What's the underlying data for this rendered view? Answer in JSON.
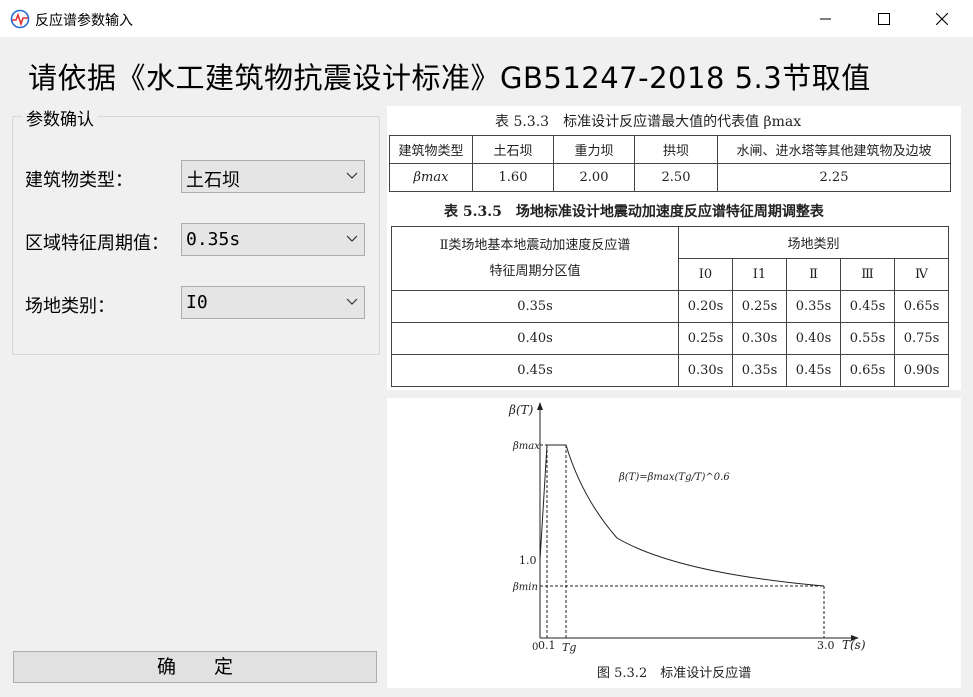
{
  "window": {
    "title": "反应谱参数输入"
  },
  "header": {
    "title": "请依据《水工建筑物抗震设计标准》GB51247-2018 5.3节取值"
  },
  "group": {
    "title": "参数确认"
  },
  "fields": {
    "building_type_label": "建筑物类型：",
    "building_type_value": "土石坝",
    "period_label": "区域特征周期值：",
    "period_value": "0.35s",
    "site_label": "场地类别：",
    "site_value": "I0"
  },
  "confirm_label": "确定",
  "table1": {
    "caption": "表 5.3.3　标准设计反应谱最大值的代表值 βmax",
    "header": [
      "建筑物类型",
      "土石坝",
      "重力坝",
      "拱坝",
      "水闸、进水塔等其他建筑物及边坡"
    ],
    "row_label": "βmax",
    "values": [
      "1.60",
      "2.00",
      "2.50",
      "2.25"
    ]
  },
  "table2": {
    "caption": "表 5.3.5　场地标准设计地震动加速度反应谱特征周期调整表",
    "left_header_line1": "Ⅱ类场地基本地震动加速度反应谱",
    "left_header_line2": "特征周期分区值",
    "group_header": "场地类别",
    "site_classes": [
      "I0",
      "I1",
      "Ⅱ",
      "Ⅲ",
      "Ⅳ"
    ],
    "rows": [
      {
        "zone": "0.35s",
        "values": [
          "0.20s",
          "0.25s",
          "0.35s",
          "0.45s",
          "0.65s"
        ]
      },
      {
        "zone": "0.40s",
        "values": [
          "0.25s",
          "0.30s",
          "0.40s",
          "0.55s",
          "0.75s"
        ]
      },
      {
        "zone": "0.45s",
        "values": [
          "0.30s",
          "0.35s",
          "0.45s",
          "0.65s",
          "0.90s"
        ]
      }
    ]
  },
  "spectrum": {
    "y_axis_label": "β(T)",
    "beta_max_label": "βmax",
    "beta_min_label": "βmin",
    "y_one_label": "1.0",
    "x_axis_label": "T(s)",
    "x_ticks": [
      "0",
      "0.1",
      "Tg",
      "3.0"
    ],
    "formula": "β(T)=βmax(Tg/T)^0.6",
    "caption": "图 5.3.2　标准设计反应谱"
  }
}
